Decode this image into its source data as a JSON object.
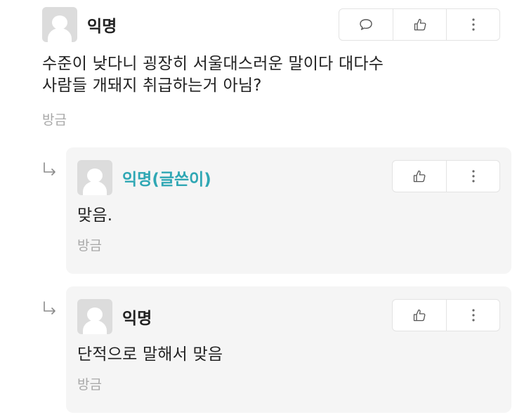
{
  "post": {
    "author": "익명",
    "text_line1": "수준이 낮다니 굉장히 서울대스러운 말이다 대다수",
    "text_line2": "사람들 개돼지 취급하는거 아님?",
    "time": "방금",
    "actions": [
      "comment-icon",
      "like-icon",
      "more-icon"
    ]
  },
  "replies": [
    {
      "author": "익명(글쓴이)",
      "is_writer": true,
      "text": "맞음.",
      "time": "방금",
      "actions": [
        "like-icon",
        "more-icon"
      ]
    },
    {
      "author": "익명",
      "is_writer": false,
      "text": "단적으로 말해서 맞음",
      "time": "방금",
      "actions": [
        "like-icon",
        "more-icon"
      ]
    }
  ],
  "colors": {
    "writer_accent": "#2fa7b4",
    "reply_background": "#f5f5f5",
    "muted_text": "#a8a8a8"
  }
}
